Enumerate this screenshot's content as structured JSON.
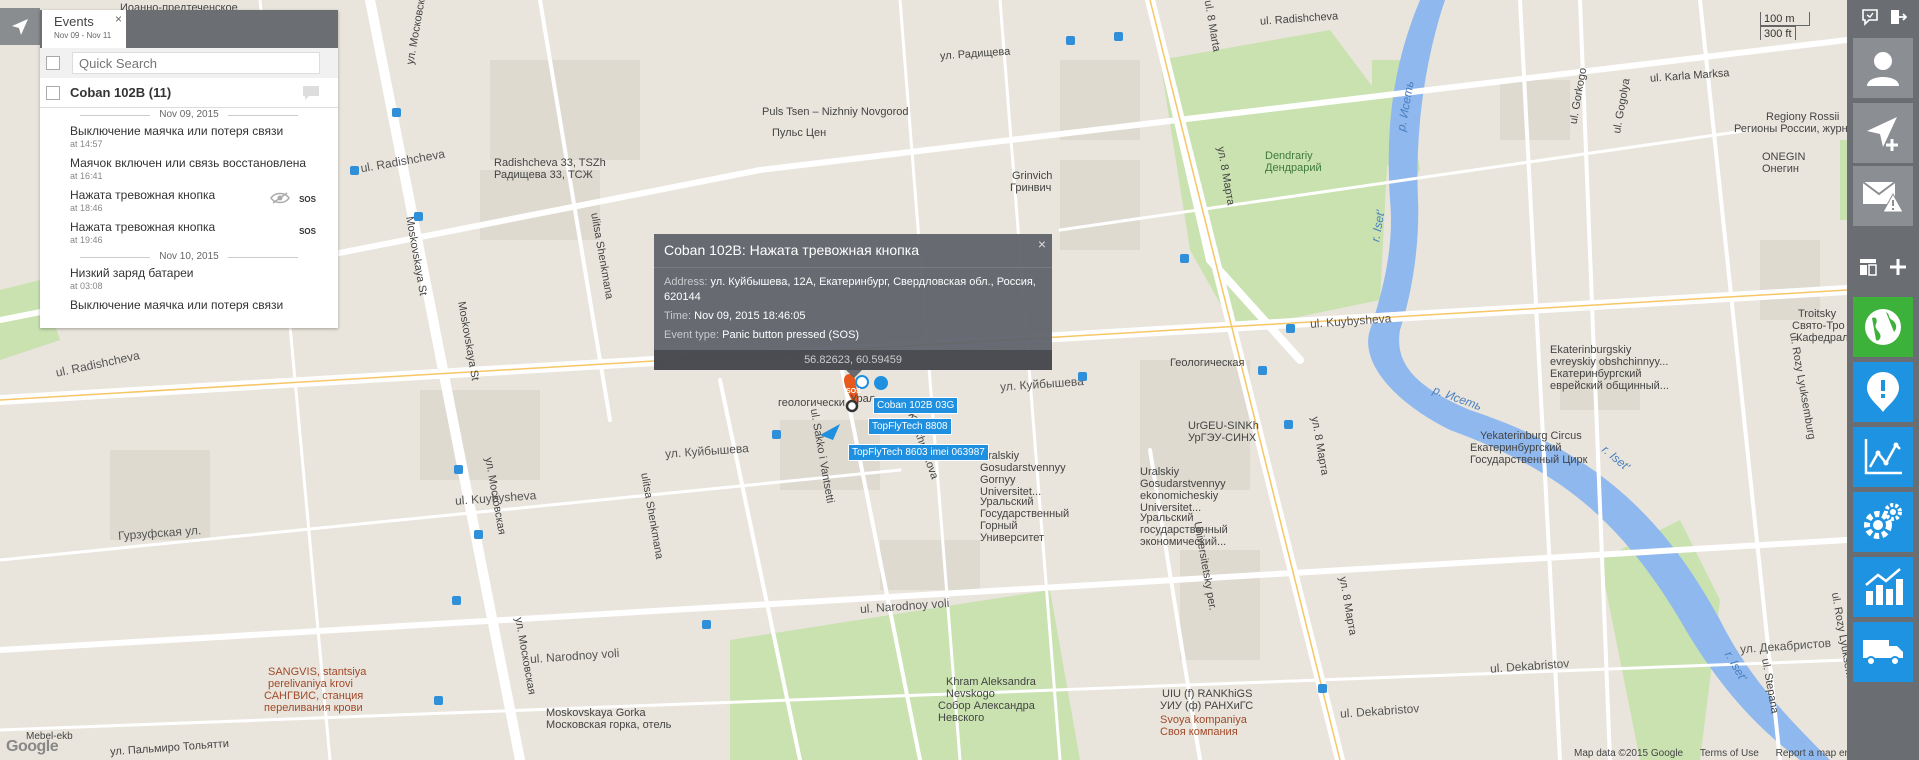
{
  "events_panel": {
    "tab_title": "Events",
    "tab_dates": "Nov 09 - Nov 11",
    "close": "×",
    "search_placeholder": "Quick Search",
    "group_title": "Coban 102B (11)",
    "date1": "Nov 09, 2015",
    "date2": "Nov 10, 2015",
    "events": [
      {
        "name": "Выключение маячка или потеря связи",
        "time": "at 14:57",
        "badge": ""
      },
      {
        "name": "Маячок включен или связь восстановлена",
        "time": "at 16:41",
        "badge": ""
      },
      {
        "name": "Нажата тревожная кнопка",
        "time": "at 18:46",
        "badge": "SOS"
      },
      {
        "name": "Нажата тревожная кнопка",
        "time": "at 19:46",
        "badge": "SOS"
      },
      {
        "name": "Низкий заряд батареи",
        "time": "at 03:08",
        "badge": ""
      },
      {
        "name": "Выключение маячка или потеря связи",
        "time": "",
        "badge": ""
      }
    ]
  },
  "popup": {
    "title": "Coban 102B: Нажата тревожная кнопка",
    "close": "×",
    "address_label": "Address:",
    "address": "ул. Куйбышева, 12А, Екатеринбург, Свердловская обл., Россия, 620144",
    "time_label": "Time:",
    "time": "Nov 09, 2015 18:46:05",
    "type_label": "Event type:",
    "type": "Panic button pressed (SOS)",
    "coords": "56.82623, 60.59459"
  },
  "trackers": {
    "t1": "Coban 102B",
    "t1_suffix": "03G",
    "t2": "TopFlyTech 8808",
    "t3": "TopFlyTech 8603 imei 063987",
    "marker_sos": "SOS"
  },
  "scale": {
    "a": "100 m",
    "b": "300 ft"
  },
  "attribution": {
    "data": "Map data ©2015 Google",
    "terms": "Terms of Use",
    "report": "Report a map error"
  },
  "google": "Google",
  "mebel": "Mebel-ekb",
  "map_labels": {
    "radishcheva_top": "ul. Radishcheva",
    "radishcheva_ru": "ул. Радищева",
    "karla_marksa": "ul. Karla Marksa",
    "puls": "Puls Tsen –\nNizhniy Novgorod",
    "puls_ru": "Пульс Цен",
    "radishcheva33": "Radishcheva 33, TSZh",
    "radishcheva33_ru": "Радищева 33, ТСЖ",
    "grinvich": "Grinvich",
    "grinvich_ru": "Гринвич",
    "dendrariy": "Dendrariy",
    "dendrariy_ru": "Дендрарий",
    "iset": "r. Iset'",
    "iset_ru": "р. Исеть",
    "iset_ru2": "р. Исеть",
    "iset2": "r. Iset'",
    "iset3": "r. Iset'",
    "regiony": "Regiony Rossii",
    "regiony_ru": "Регионы России, журнал",
    "onegin": "ONEGIN",
    "onegin_ru": "Онегин",
    "troitsky": "Troitsky",
    "troitsky_ru": "Свято-Тро",
    "troitsky_ru2": "Кафедрал",
    "kuybysheva": "ul. Kuybysheva",
    "kuybysheva_ru": "ул. Куйбышева",
    "kuybysheva_ru2": "ул. Куйбышева",
    "kuybysheva_left": "ul. Kuybysheva",
    "radishcheva_left": "ul. Radishcheva",
    "gurzuf": "Гурзуфская ул.",
    "moskovskaya_ru": "ул. Московская",
    "moskovskaya_ru2": "ул. Московская",
    "moskovskaya_st": "Moskovskaya St",
    "shenkmana": "ulitsa Shenkmana",
    "shenkmana2": "ulitsa Shenkmana",
    "sakko": "ul. Sakko i Vantsetti",
    "narodnoy": "ul. Narodnoy voli",
    "narodnoy2": "ul. Narodnoy voli",
    "dekabristov": "ul. Dekabristov",
    "dekabristov2": "ul. Dekabristov",
    "dekabristov_ru": "ул. Декабристов",
    "geology": "Геологическая",
    "urgeu": "UrGEU-SINKh",
    "urgeu_ru": "УрГЭУ-СИНХ",
    "ugeu": "Uralskiy\nGosudarstvennyy\nekonomicheskiy\nUniversitet...",
    "ugeu_ru": "Уральский\nгосударственный\nэкономический...",
    "gorny": "Uralskiy\nGosudarstvennyy\nGornyy\nUniversitet...",
    "gorny_ru": "Уральский\nГосударственный\nГорный\nУниверситет",
    "circus": "Yekaterinburg Circus",
    "circus_ru": "Екатеринбургский\nГосударственный Цирк",
    "ekat_evr": "Ekaterinburgskiy\nevreyskiy obshchinnyy...",
    "ekat_evr_ru": "Екатеринбургский\nеврейский общинный...",
    "khram": "Khram Aleksandra\nNevskogo",
    "khram_ru": "Собор Александра\nНевского",
    "moskovskaya_gorka": "Moskovskaya Gorka",
    "moskovskaya_gorka_ru": "Московская горка, отель",
    "tolyatti": "ул. Пальмиро Тольятти",
    "sangvis": "SANGVIS, stantsiya\nperelivaniya krovi",
    "sangvis_ru": "САНГВИС, станция\nпереливания крови",
    "uiu": "UIU (f) RANKhiGS",
    "uiu_ru": "УИУ (ф) РАНХиГС",
    "svoya": "Svoya kompaniya",
    "svoya_ru": "Своя компания",
    "gorky": "ul. Gorkogo",
    "gogolya": "ul. Gogolya",
    "8marta": "ul. 8 Marta",
    "8marta_ru": "ул. 8 Марта",
    "8marta_ru2": "ул. 8 Марта",
    "8marta_ru3": "ул. 8 Марта",
    "radishcheva_right": "ul. Radishcheva",
    "universitetsky": "Universitetsky per.",
    "lyuksemburg": "ul. Rozy Lyuksemburg",
    "lyuksemburg2": "ul. Rozy Lyuksemburg",
    "lyuksemburg3": "ul. Rozy Lyuksemburg",
    "stepana": "ul. Stepana",
    "vaynera": "Vaynera",
    "khokhryakova": "Khokhryakova",
    "ivanovo": "Иоанно-предтеченское",
    "ur_geo": "Урал",
    "geol": "геологически"
  },
  "colors": {
    "toolbar": "#6a6d72",
    "green": "#3db23b",
    "blue": "#1e93e2",
    "tracker": "#1f8fe0",
    "marker": "#e8591e"
  }
}
